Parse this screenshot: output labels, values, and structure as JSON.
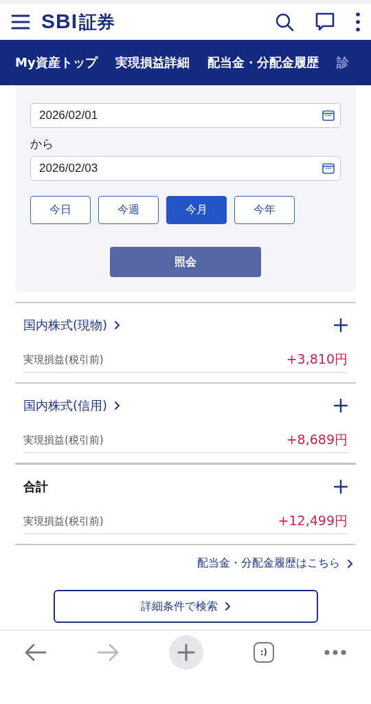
{
  "header": {
    "logo_latin": "SBI",
    "logo_kanji": "証券"
  },
  "nav_tabs": [
    {
      "label": "My資産トップ"
    },
    {
      "label": "実現損益詳細"
    },
    {
      "label": "配当金・分配金履歴"
    },
    {
      "label": "診"
    }
  ],
  "date_from": {
    "value": "2026/02/01"
  },
  "from_label": "から",
  "date_to": {
    "value": "2026/02/03"
  },
  "periods": [
    {
      "label": "今日",
      "selected": false
    },
    {
      "label": "今週",
      "selected": false
    },
    {
      "label": "今月",
      "selected": true
    },
    {
      "label": "今年",
      "selected": false
    }
  ],
  "query_button": "照会",
  "sections": [
    {
      "title": "国内株式(現物)",
      "link": true,
      "row_label": "実現損益(税引前)",
      "row_value": "+3,810円"
    },
    {
      "title": "国内株式(信用)",
      "link": true,
      "row_label": "実現損益(税引前)",
      "row_value": "+8,689円"
    },
    {
      "title": "合計",
      "link": false,
      "row_label": "実現損益(税引前)",
      "row_value": "+12,499円"
    }
  ],
  "dividend_link": "配当金・分配金履歴はこちら",
  "search_button": "詳細条件で検索",
  "browser_toolbar": {
    "tabs_label": ":)"
  }
}
